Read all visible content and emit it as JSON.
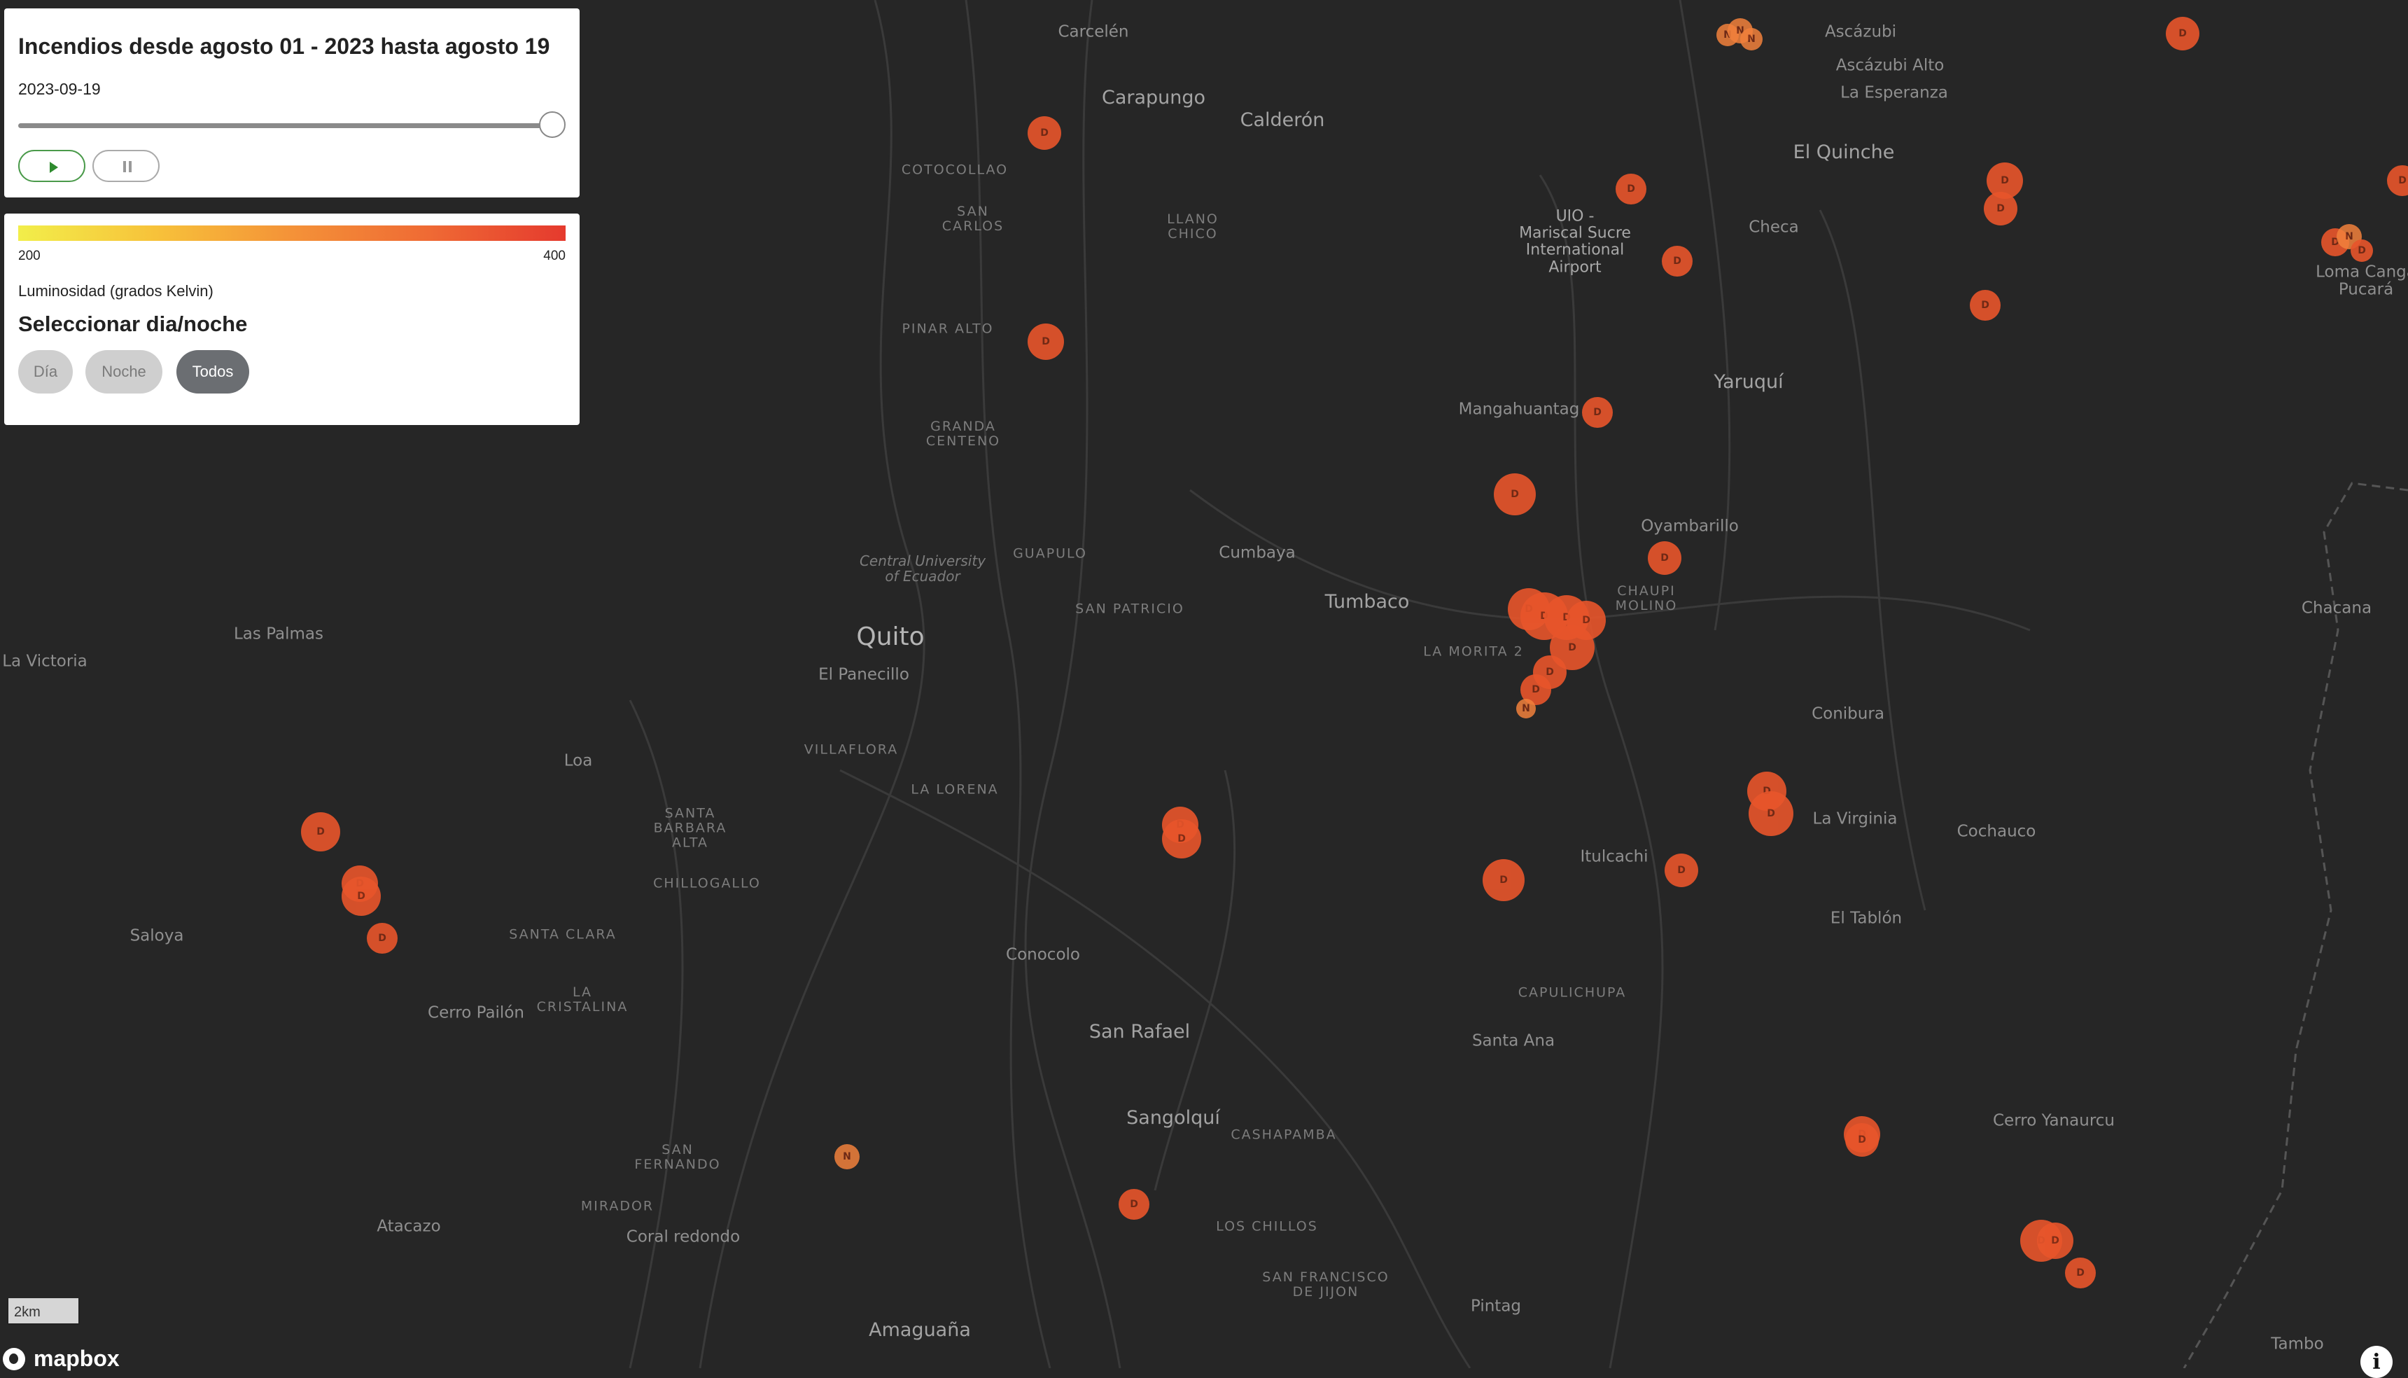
{
  "slider": {
    "title": "Incendios desde agosto 01 - 2023 hasta agosto 19",
    "date": "2023-09-19",
    "value": 1.0
  },
  "legend": {
    "min": "200",
    "max": "400",
    "caption": "Luminosidad (grados Kelvin)",
    "heading": "Seleccionar dia/noche",
    "options": [
      "Día",
      "Noche",
      "Todos"
    ],
    "selected": "Todos"
  },
  "map": {
    "scale_label": "2km",
    "attribution": "mapbox",
    "info_glyph": "i",
    "places": [
      "Carcelén",
      "Carapungo",
      "Calderón",
      "COTOCOLLAO",
      "SAN CARLOS",
      "LLANO CHICO",
      "PINAR ALTO",
      "GRANDA CENTENO",
      "Central University of Ecuador",
      "GUAPULO",
      "Cumbaya",
      "Tumbaco",
      "SAN PATRICIO",
      "LA MORITA 2",
      "Quito",
      "El Panecillo",
      "VILLAFLORA",
      "LA LORENA",
      "SANTA BARBARA ALTA",
      "CHILLOGALLO",
      "SANTA CLARA",
      "LA CRISTALINA",
      "Conocolo",
      "San Rafael",
      "Sangolquí",
      "CASHAPAMBA",
      "SAN FERNANDO",
      "MIRADOR",
      "Coral redondo",
      "LOS CHILLOS",
      "SAN FRANCISCO DE JIJON",
      "Pintag",
      "Amaguaña",
      "Atacazo",
      "Saloya",
      "Cerro Pailón",
      "Las Palmas",
      "La Victoria",
      "Loa",
      "Ascázubi",
      "Ascázubi Alto",
      "La Esperanza",
      "El Quinche",
      "Checa",
      "UIO - Mariscal Sucre International Airport",
      "Yaruquí",
      "Mangahuantag",
      "Oyambarillo",
      "CHAUPI MOLINO",
      "Conibura",
      "La Virginia",
      "Cochauco",
      "Itulcachi",
      "El Tablón",
      "CAPULICHUPA",
      "Santa Ana",
      "Cerro Yanaurcu",
      "Chacana",
      "Loma Canga Pucará",
      "Tambo"
    ],
    "fires_label_day": "D",
    "fires_label_night": "N",
    "fire_color": "#e8552b"
  }
}
